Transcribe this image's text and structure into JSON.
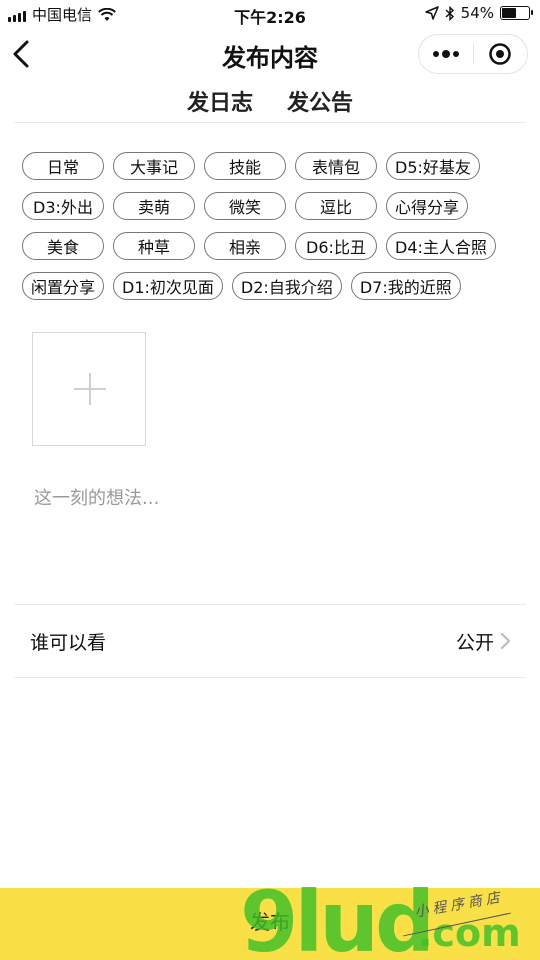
{
  "status_bar": {
    "carrier": "中国电信",
    "time": "下午2:26",
    "battery_percent_text": "54%",
    "battery_level": 0.54
  },
  "nav": {
    "title": "发布内容"
  },
  "tabs": [
    {
      "label": "发日志"
    },
    {
      "label": "发公告"
    }
  ],
  "tags": {
    "row1": [
      "日常",
      "大事记",
      "技能",
      "表情包",
      "D5:好基友"
    ],
    "row2": [
      "D3:外出",
      "卖萌",
      "微笑",
      "逗比",
      "心得分享"
    ],
    "row3": [
      "美食",
      "种草",
      "相亲",
      "D6:比丑",
      "D4:主人合照"
    ],
    "row4": [
      "闲置分享",
      "D1:初次见面",
      "D2:自我介绍",
      "D7:我的近照"
    ]
  },
  "editor": {
    "placeholder": "这一刻的想法..."
  },
  "visibility": {
    "label": "谁可以看",
    "value": "公开"
  },
  "publish": {
    "label": "发布"
  },
  "watermark": {
    "logo": "9lud",
    "domain": ".com",
    "subtitle": "小程序商店"
  },
  "colors": {
    "publish_bar": "#f8e046",
    "watermark_green": "#3cbe28"
  }
}
